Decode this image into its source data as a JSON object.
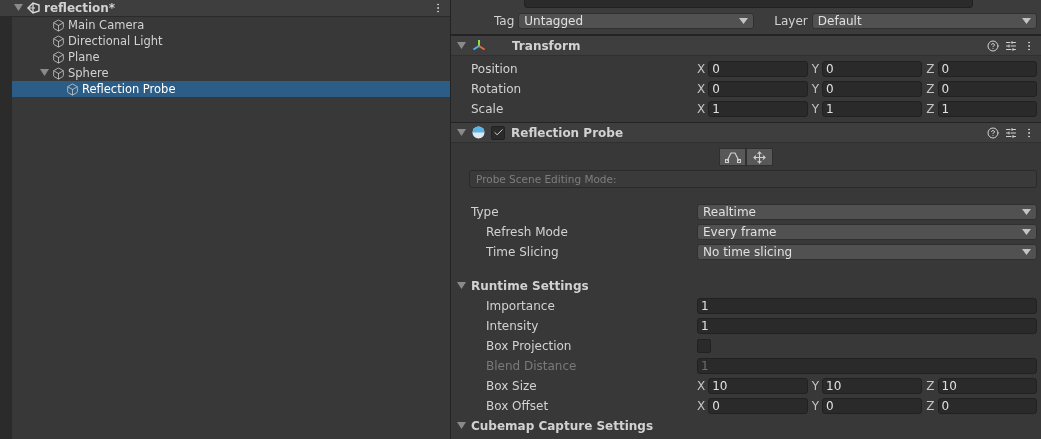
{
  "hierarchy": {
    "scene": {
      "label": "reflection*",
      "expanded": true
    },
    "items": [
      {
        "label": "Main Camera",
        "selected": false
      },
      {
        "label": "Directional Light",
        "selected": false
      },
      {
        "label": "Plane",
        "selected": false
      },
      {
        "label": "Sphere",
        "selected": false,
        "expanded": true,
        "children": [
          {
            "label": "Reflection Probe",
            "selected": true
          }
        ]
      }
    ]
  },
  "inspector": {
    "tag": {
      "label": "Tag",
      "value": "Untagged"
    },
    "layer": {
      "label": "Layer",
      "value": "Default"
    },
    "components": [
      {
        "kind": "transform",
        "title": "Transform",
        "expanded": true,
        "rows": [
          {
            "kind": "vector",
            "label": "Position",
            "axes": [
              {
                "axis": "X",
                "value": "0"
              },
              {
                "axis": "Y",
                "value": "0"
              },
              {
                "axis": "Z",
                "value": "0"
              }
            ]
          },
          {
            "kind": "vector",
            "label": "Rotation",
            "axes": [
              {
                "axis": "X",
                "value": "0"
              },
              {
                "axis": "Y",
                "value": "0"
              },
              {
                "axis": "Z",
                "value": "0"
              }
            ]
          },
          {
            "kind": "vector",
            "label": "Scale",
            "axes": [
              {
                "axis": "X",
                "value": "1"
              },
              {
                "axis": "Y",
                "value": "1"
              },
              {
                "axis": "Z",
                "value": "1"
              }
            ]
          }
        ]
      },
      {
        "kind": "probe",
        "title": "Reflection Probe",
        "expanded": true,
        "enabled": true,
        "rows": [
          {
            "kind": "edit-tools"
          },
          {
            "kind": "info",
            "placeholder": "Probe Scene Editing Mode:"
          },
          {
            "kind": "spacer"
          },
          {
            "kind": "dropdown",
            "label": "Type",
            "value": "Realtime",
            "children": [
              {
                "kind": "dropdown",
                "label": "Refresh Mode",
                "value": "Every frame"
              },
              {
                "kind": "dropdown",
                "label": "Time Slicing",
                "value": "No time slicing"
              }
            ]
          },
          {
            "kind": "spacer"
          },
          {
            "kind": "section",
            "label": "Runtime Settings",
            "expanded": true,
            "children": [
              {
                "kind": "number",
                "label": "Importance",
                "value": "1",
                "disabled": false
              },
              {
                "kind": "number",
                "label": "Intensity",
                "value": "1",
                "disabled": false
              },
              {
                "kind": "checkbox",
                "label": "Box Projection",
                "checked": false
              },
              {
                "kind": "number",
                "label": "Blend Distance",
                "value": "1",
                "disabled": true
              },
              {
                "kind": "vector",
                "label": "Box Size",
                "axes": [
                  {
                    "axis": "X",
                    "value": "10"
                  },
                  {
                    "axis": "Y",
                    "value": "10"
                  },
                  {
                    "axis": "Z",
                    "value": "10"
                  }
                ]
              },
              {
                "kind": "vector",
                "label": "Box Offset",
                "axes": [
                  {
                    "axis": "X",
                    "value": "0"
                  },
                  {
                    "axis": "Y",
                    "value": "0"
                  },
                  {
                    "axis": "Z",
                    "value": "0"
                  }
                ]
              }
            ]
          },
          {
            "kind": "section",
            "label": "Cubemap Capture Settings",
            "expanded": true
          }
        ]
      }
    ]
  }
}
